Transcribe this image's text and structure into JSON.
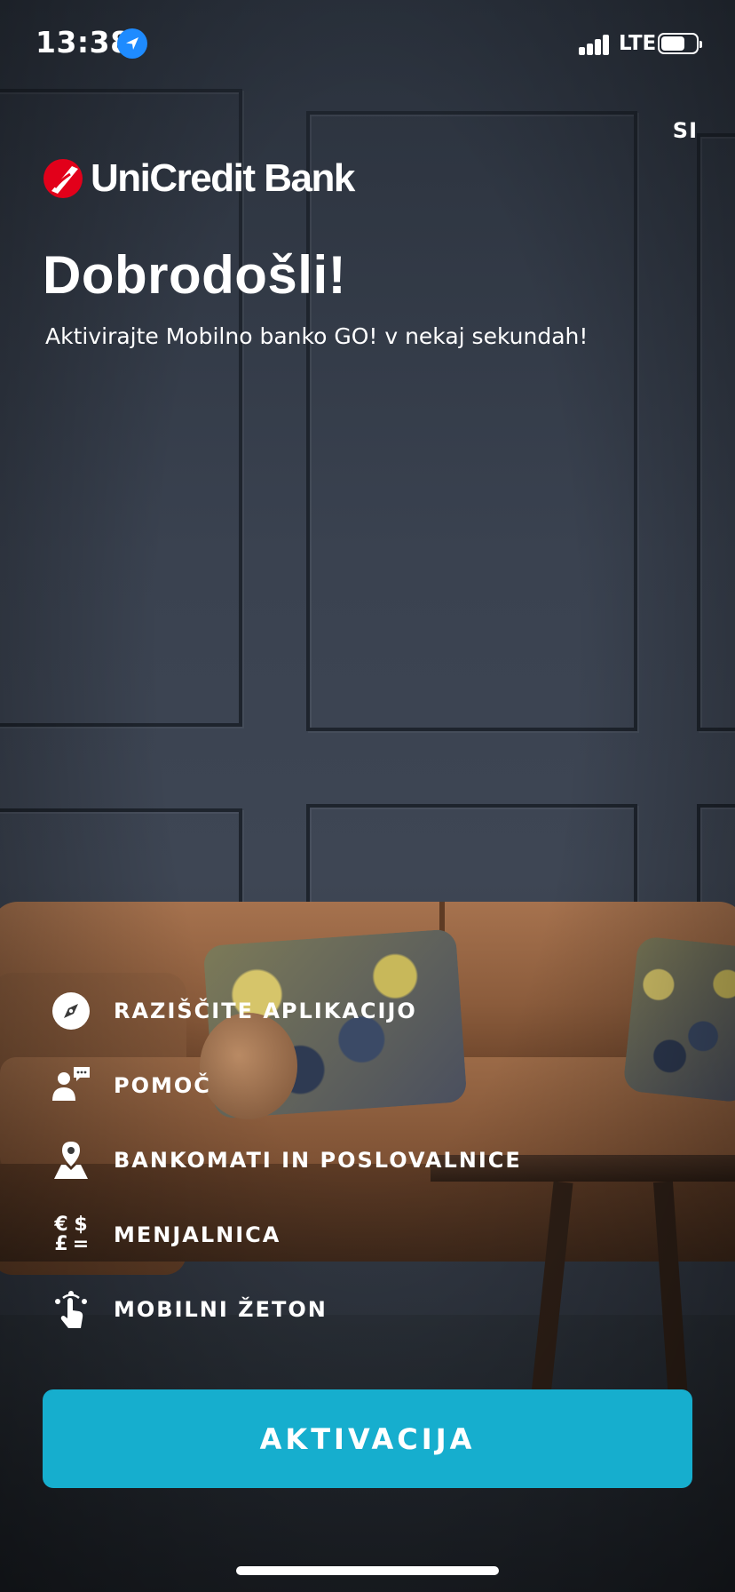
{
  "status_bar": {
    "time": "13:38",
    "network": "LTE",
    "icons": [
      "location-arrow-icon",
      "cellular-signal-icon",
      "battery-icon"
    ]
  },
  "header": {
    "language": "SI",
    "brand": "UniCredit Bank",
    "title": "Dobrodošli!",
    "subtitle": "Aktivirajte Mobilno banko GO! v nekaj sekundah!"
  },
  "menu": {
    "items": [
      {
        "label": "RAZIŠČITE APLIKACIJO",
        "icon": "compass-icon"
      },
      {
        "label": "POMOČ",
        "icon": "help-chat-icon"
      },
      {
        "label": "BANKOMATI IN POSLOVALNICE",
        "icon": "map-pin-icon"
      },
      {
        "label": "MENJALNICA",
        "icon": "currency-exchange-icon",
        "symbols": [
          "€",
          "$",
          "£",
          "="
        ]
      },
      {
        "label": "MOBILNI ŽETON",
        "icon": "touch-token-icon"
      }
    ]
  },
  "cta": {
    "label": "AKTIVACIJA"
  },
  "colors": {
    "accent": "#16aece",
    "brand_red": "#e2001a",
    "location_blue": "#1e8bff",
    "text": "#ffffff"
  }
}
